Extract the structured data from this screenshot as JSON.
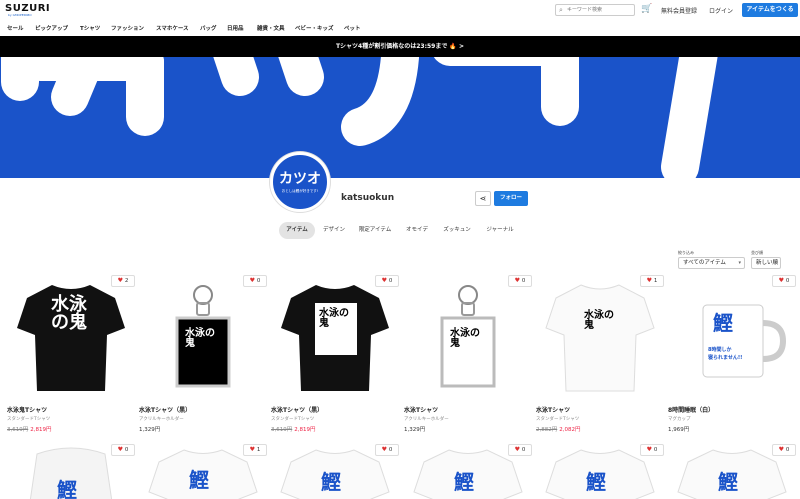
{
  "header": {
    "logo": "SUZURI",
    "logo_sub": "by GMOPEPABO",
    "search_placeholder": "キーワード検索",
    "signup": "無料会員登録",
    "login": "ログイン",
    "make_button": "アイテムをつくる"
  },
  "categories": [
    "セール",
    "ピックアップ",
    "Tシャツ",
    "ファッション",
    "スマホケース",
    "バッグ",
    "日用品",
    "雑貨・文具",
    "ベビー・キッズ",
    "ペット"
  ],
  "promo": "Tシャツ4種が割引価格なのは23:59まで 🔥 >",
  "banner": {
    "text": "カツオ"
  },
  "profile": {
    "avatar_title": "カツオ",
    "avatar_sub": "おとしは鰹が好きです!",
    "username": "katsuokun",
    "follow": "フォロー"
  },
  "tabs": [
    {
      "label": "アイテム",
      "active": true
    },
    {
      "label": "デザイン",
      "active": false
    },
    {
      "label": "限定アイテム",
      "active": false
    },
    {
      "label": "オモイデ",
      "active": false
    },
    {
      "label": "ズッキュン",
      "active": false
    },
    {
      "label": "ジャーナル",
      "active": false
    }
  ],
  "filters": {
    "narrow_label": "絞り込み",
    "narrow_value": "すべてのアイテム",
    "sort_label": "並び順",
    "sort_value": "新しい順"
  },
  "products": [
    {
      "title": "水泳鬼Tシャツ",
      "sub": "スタンダードTシャツ",
      "old_price": "3,619円",
      "price": "2,819円",
      "favs": "2"
    },
    {
      "title": "水泳Tシャツ（黒）",
      "sub": "アクリルキーホルダー",
      "old_price": "",
      "price": "1,329円",
      "favs": "0"
    },
    {
      "title": "水泳Tシャツ（黒）",
      "sub": "スタンダードTシャツ",
      "old_price": "3,619円",
      "price": "2,819円",
      "favs": "0"
    },
    {
      "title": "水泳Tシャツ",
      "sub": "アクリルキーホルダー",
      "old_price": "",
      "price": "1,329円",
      "favs": "0"
    },
    {
      "title": "水泳Tシャツ",
      "sub": "スタンダードTシャツ",
      "old_price": "2,882円",
      "price": "2,082円",
      "favs": "1"
    },
    {
      "title": "8時間睡眠（白）",
      "sub": "マグカップ",
      "old_price": "",
      "price": "1,969円",
      "favs": "0"
    }
  ],
  "row2_favs": [
    "0",
    "1",
    "0",
    "0",
    "0",
    "0"
  ],
  "design_text": {
    "suiei": "水泳の鬼",
    "katsuo": "鰹",
    "mug_line1": "8時間しか",
    "mug_line2": "寝られません!!"
  }
}
